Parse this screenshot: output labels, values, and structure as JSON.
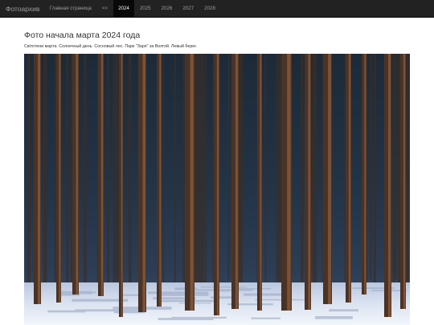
{
  "navbar": {
    "brand": "Фотоархив",
    "items": [
      {
        "label": "Главная страница",
        "active": false
      },
      {
        "label": "<<",
        "active": false
      },
      {
        "label": "2024",
        "active": true
      },
      {
        "label": "2025",
        "active": false
      },
      {
        "label": "2026",
        "active": false
      },
      {
        "label": "2027",
        "active": false
      },
      {
        "label": "2028",
        "active": false
      }
    ]
  },
  "colors": {
    "navbar_bg": "#222222",
    "nav_active_bg": "#080808",
    "nav_text": "#9d9d9d",
    "text": "#333333"
  },
  "main": {
    "title": "Фото начала марта 2024 года",
    "description": "Світотени марта. Солнечный день. Сосновый лес. Парк \"Заря\" за Волгой. Левый берег."
  }
}
